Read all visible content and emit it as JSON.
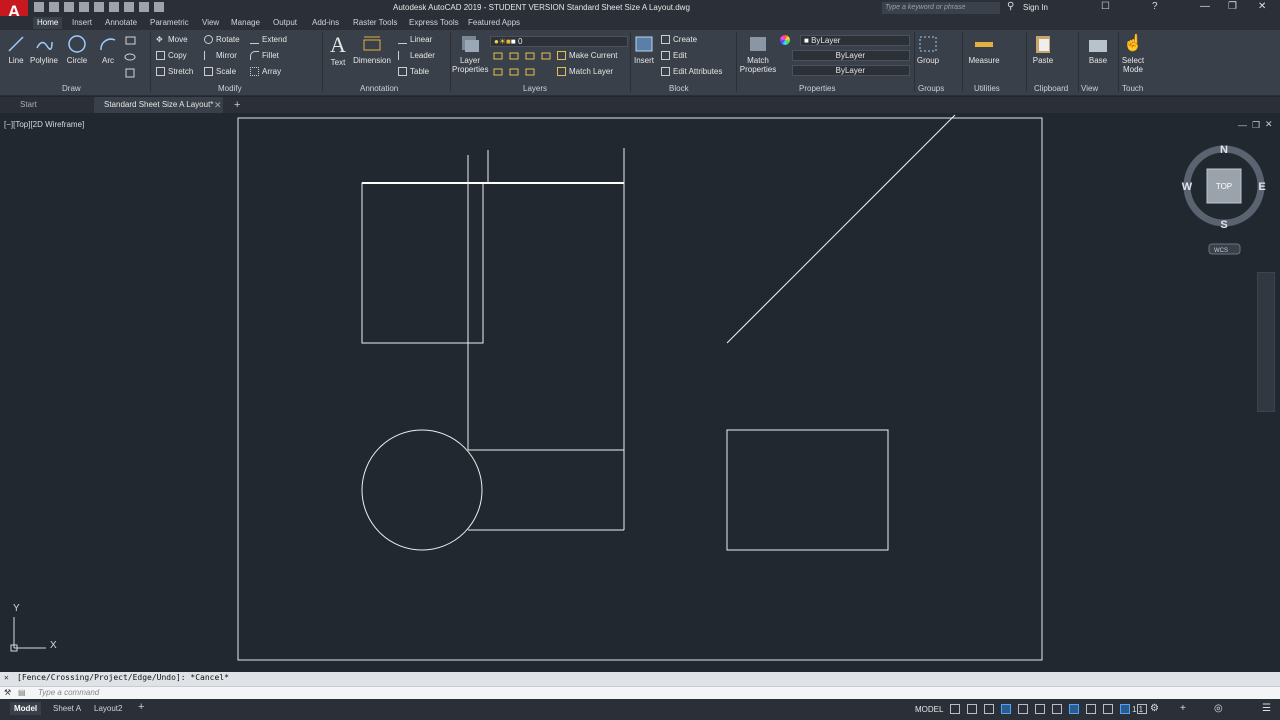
{
  "window": {
    "title": "Autodesk AutoCAD 2019 - STUDENT VERSION    Standard Sheet Size A Layout.dwg",
    "app_letter": "A",
    "search_placeholder": "Type a keyword or phrase",
    "sign_in": "Sign In"
  },
  "ribbon_tabs": [
    "Home",
    "Insert",
    "Annotate",
    "Parametric",
    "View",
    "Manage",
    "Output",
    "Add-ins",
    "Raster Tools",
    "Express Tools",
    "Featured Apps"
  ],
  "ribbon": {
    "draw": {
      "title": "Draw",
      "line": "Line",
      "polyline": "Polyline",
      "circle": "Circle",
      "arc": "Arc"
    },
    "modify": {
      "title": "Modify",
      "move": "Move",
      "rotate": "Rotate",
      "extend": "Extend",
      "copy": "Copy",
      "mirror": "Mirror",
      "fillet": "Fillet",
      "stretch": "Stretch",
      "scale": "Scale",
      "array": "Array"
    },
    "annotation": {
      "title": "Annotation",
      "text": "Text",
      "dimension": "Dimension",
      "linear": "Linear",
      "leader": "Leader",
      "table": "Table"
    },
    "layers": {
      "title": "Layers",
      "layer_properties_1": "Layer",
      "layer_properties_2": "Properties",
      "current_layer": "0",
      "make_current": "Make Current",
      "match_layer": "Match Layer"
    },
    "block": {
      "title": "Block",
      "insert": "Insert",
      "create": "Create",
      "edit": "Edit",
      "edit_attributes": "Edit Attributes"
    },
    "properties": {
      "title": "Properties",
      "match_1": "Match",
      "match_2": "Properties",
      "color": "ByLayer",
      "linetype": "ByLayer",
      "lineweight": "ByLayer"
    },
    "groups": {
      "title": "Groups",
      "group": "Group"
    },
    "utilities": {
      "title": "Utilities",
      "measure": "Measure"
    },
    "clipboard": {
      "title": "Clipboard",
      "paste": "Paste"
    },
    "view": {
      "title": "View",
      "base": "Base"
    },
    "touch": {
      "title": "Touch",
      "select_1": "Select",
      "select_2": "Mode"
    }
  },
  "doc_tabs": [
    "Start",
    "Standard Sheet Size A Layout*"
  ],
  "viewport_label": "[−][Top][2D Wireframe]",
  "viewcube": {
    "n": "N",
    "s": "S",
    "e": "E",
    "w": "W",
    "face": "TOP",
    "wcs": "WCS"
  },
  "ucs": {
    "x": "X",
    "y": "Y"
  },
  "command": {
    "history": "[Fence/Crossing/Project/Edge/Undo]: *Cancel*",
    "placeholder": "Type a command"
  },
  "layout_tabs": [
    "Model",
    "Sheet A",
    "Layout2"
  ],
  "status": {
    "model": "MODEL",
    "scale": "1:1"
  }
}
